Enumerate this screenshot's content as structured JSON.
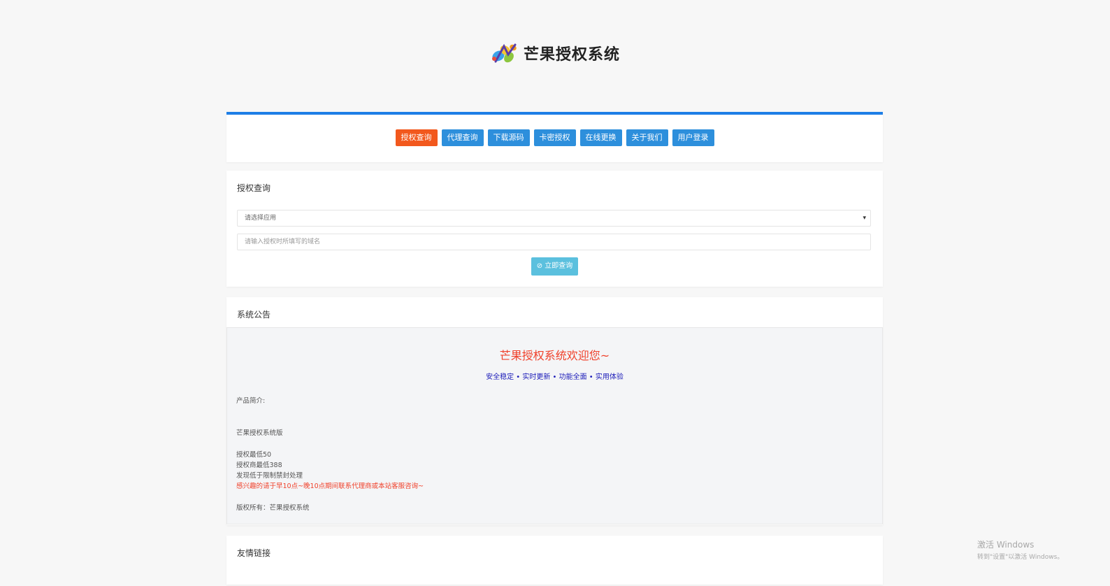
{
  "logo": {
    "title": "芒果授权系统",
    "icon": "mango-logo-icon"
  },
  "nav": {
    "buttons": [
      {
        "label": "授权查询",
        "active": true
      },
      {
        "label": "代理查询",
        "active": false
      },
      {
        "label": "下载源码",
        "active": false
      },
      {
        "label": "卡密授权",
        "active": false
      },
      {
        "label": "在线更换",
        "active": false
      },
      {
        "label": "关于我们",
        "active": false
      },
      {
        "label": "用户登录",
        "active": false
      }
    ],
    "accent_color": "#1e7ee6",
    "active_color": "#f2581d",
    "button_color": "#2d8fdc"
  },
  "query": {
    "title": "授权查询",
    "select_value": "请选择应用",
    "input_placeholder": "请输入授权时所填写的域名",
    "submit_label": "立即查询",
    "submit_icon": "search-circle-icon",
    "submit_color": "#5bc0de"
  },
  "notice": {
    "title": "系统公告",
    "welcome": "芒果授权系统欢迎您~",
    "tagline": "安全稳定 • 实时更新 • 功能全面 • 实用体验",
    "intro_label": "产品简介:",
    "product_name": "芒果授权系统版",
    "price_lines": [
      "授权最低50",
      "授权商最低388",
      "发现低于限制禁封处理"
    ],
    "contact_line": "感兴趣的请于早10点~晚10点期间联系代理商或本站客服咨询~",
    "copyright": "版权所有：芒果授权系统",
    "welcome_color": "#f0402a",
    "tagline_color": "#1a1ab8"
  },
  "links": {
    "title": "友情链接"
  },
  "watermark": {
    "line1": "激活 Windows",
    "line2": "转到\"设置\"以激活 Windows。"
  }
}
